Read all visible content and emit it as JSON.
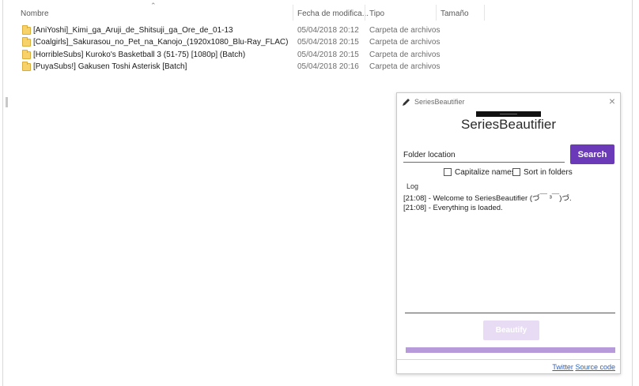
{
  "explorer": {
    "columns": {
      "name": "Nombre",
      "date": "Fecha de modifica...",
      "type": "Tipo",
      "size": "Tamaño"
    },
    "rows": [
      {
        "name": "[AniYoshi]_Kimi_ga_Aruji_de_Shitsuji_ga_Ore_de_01-13",
        "date": "05/04/2018 20:12",
        "type": "Carpeta de archivos"
      },
      {
        "name": "[Coalgirls]_Sakurasou_no_Pet_na_Kanojo_(1920x1080_Blu-Ray_FLAC)",
        "date": "05/04/2018 20:15",
        "type": "Carpeta de archivos"
      },
      {
        "name": "[HorribleSubs] Kuroko's Basketball 3 (51-75) [1080p] (Batch)",
        "date": "05/04/2018 20:15",
        "type": "Carpeta de archivos"
      },
      {
        "name": "[PuyaSubs!] Gakusen Toshi Asterisk [Batch]",
        "date": "05/04/2018 20:16",
        "type": "Carpeta de archivos"
      }
    ]
  },
  "dialog": {
    "window_title": "SeriesBeautifier",
    "app_name": "SeriesBeautifier",
    "folder_placeholder": "Folder location",
    "search_label": "Search",
    "capitalize_label": "Capitalize names",
    "sort_label": "Sort in folders",
    "log_label": "Log",
    "log_lines": [
      "[21:08] - Welcome to SeriesBeautifier (づ￣ ³￣)づ.",
      "[21:08] - Everything is loaded."
    ],
    "beautify_label": "Beautify",
    "progress": 1.0,
    "twitter_label": "Twitter",
    "source_label": "Source code",
    "accent_color": "#6a3ab8"
  }
}
